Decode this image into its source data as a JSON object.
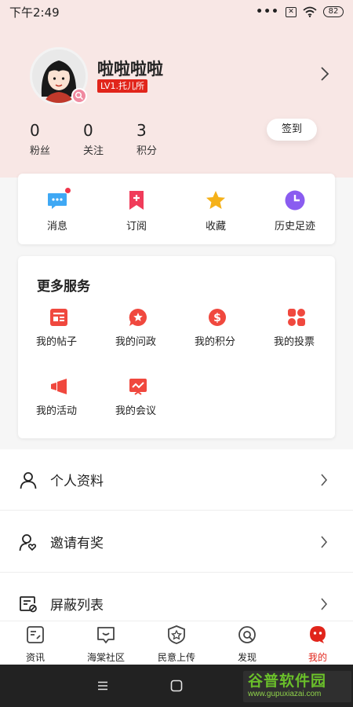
{
  "status": {
    "time": "下午2:49",
    "dots": "•••",
    "sim": "✕",
    "battery": "82"
  },
  "profile": {
    "username": "啦啦啦啦",
    "level": "LV1.托儿所"
  },
  "stats": [
    {
      "value": "0",
      "label": "粉丝"
    },
    {
      "value": "0",
      "label": "关注"
    },
    {
      "value": "3",
      "label": "积分"
    }
  ],
  "checkin_label": "签到",
  "quick": [
    {
      "label": "消息",
      "icon": "message-icon"
    },
    {
      "label": "订阅",
      "icon": "subscribe-icon"
    },
    {
      "label": "收藏",
      "icon": "star-icon"
    },
    {
      "label": "历史足迹",
      "icon": "clock-icon"
    }
  ],
  "services": {
    "title": "更多服务",
    "items": [
      {
        "label": "我的帖子",
        "icon": "posts-icon"
      },
      {
        "label": "我的问政",
        "icon": "inquiry-icon"
      },
      {
        "label": "我的积分",
        "icon": "points-icon"
      },
      {
        "label": "我的投票",
        "icon": "vote-icon"
      },
      {
        "label": "我的活动",
        "icon": "activity-icon"
      },
      {
        "label": "我的会议",
        "icon": "meeting-icon"
      }
    ]
  },
  "menu": [
    {
      "label": "个人资料",
      "icon": "person-icon"
    },
    {
      "label": "邀请有奖",
      "icon": "invite-icon"
    },
    {
      "label": "屏蔽列表",
      "icon": "block-list-icon"
    }
  ],
  "tabs": [
    {
      "label": "资讯",
      "icon": "news-icon"
    },
    {
      "label": "海棠社区",
      "icon": "community-icon"
    },
    {
      "label": "民意上传",
      "icon": "upload-icon"
    },
    {
      "label": "发现",
      "icon": "discover-icon"
    },
    {
      "label": "我的",
      "icon": "mine-icon",
      "active": true
    }
  ],
  "watermark": {
    "name": "谷普软件园",
    "url": "www.gupuxiazai.com"
  },
  "colors": {
    "accent": "#e1251b",
    "header_bg": "#f8e7e5",
    "section_bg": "#f6f6f6"
  }
}
